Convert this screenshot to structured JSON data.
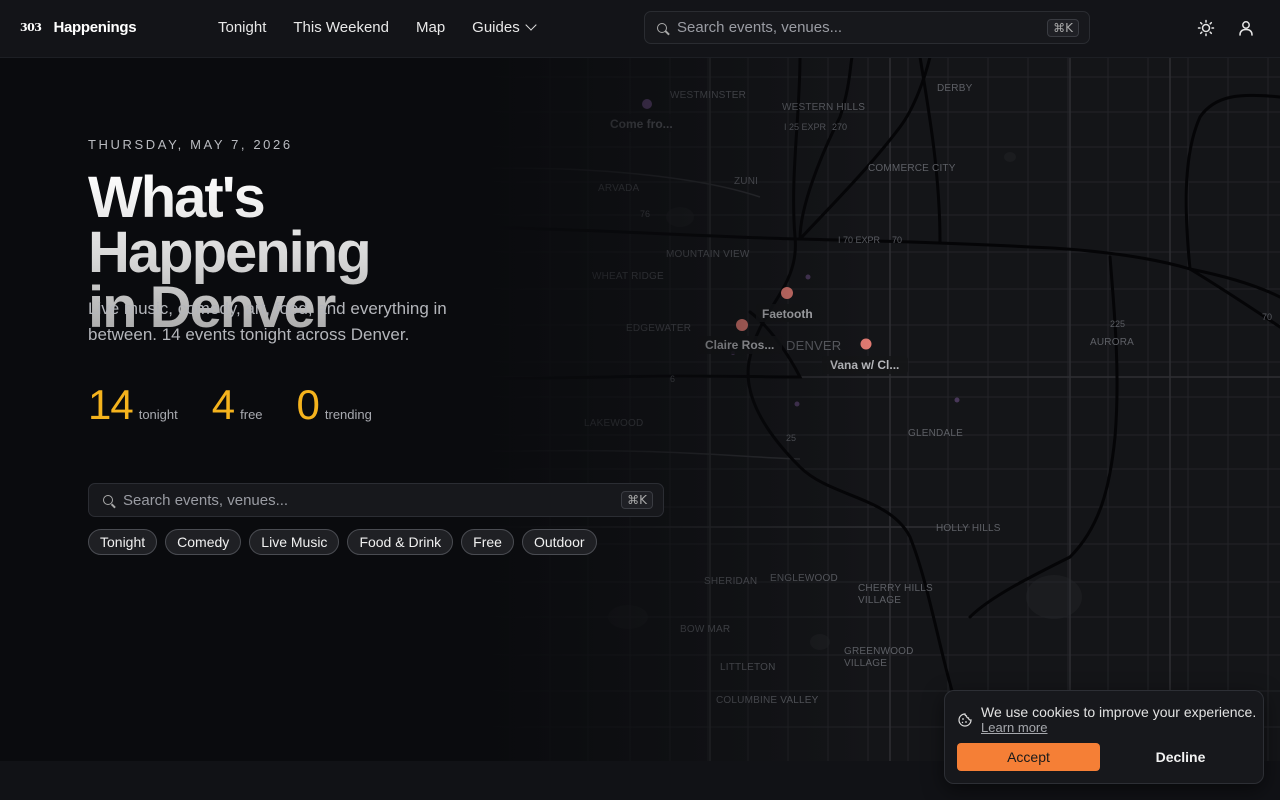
{
  "brand": {
    "mark": "303",
    "name": "Happenings"
  },
  "nav": {
    "items": [
      "Tonight",
      "This Weekend",
      "Map",
      "Guides"
    ]
  },
  "search": {
    "placeholder": "Search events, venues...",
    "shortcut": "⌘K"
  },
  "hero": {
    "date": "THURSDAY, MAY 7, 2026",
    "title_line1": "What's Happening",
    "title_line2": "in Denver",
    "subtitle": "Live music, comedy, art, food, and everything in between. 14 events tonight across Denver.",
    "stats": [
      {
        "value": "14",
        "label": "tonight"
      },
      {
        "value": "4",
        "label": "free"
      },
      {
        "value": "0",
        "label": "trending"
      }
    ],
    "chips": [
      "Tonight",
      "Comedy",
      "Live Music",
      "Food & Drink",
      "Free",
      "Outdoor"
    ]
  },
  "map": {
    "places": [
      "WESTMINSTER",
      "WESTERN HILLS",
      "DERBY",
      "COMMERCE CITY",
      "ARVADA",
      "ZUNI",
      "MOUNTAIN VIEW",
      "WHEAT RIDGE",
      "EDGEWATER",
      "DENVER",
      "AURORA",
      "LAKEWOOD",
      "GLENDALE",
      "HOLLY HILLS",
      "SHERIDAN",
      "ENGLEWOOD",
      "CHERRY HILLS",
      "VILLAGE",
      "BOW MAR",
      "GREENWOOD",
      "VILLAGE",
      "LITTLETON",
      "COLUMBINE VALLEY"
    ],
    "highways": [
      "I 25 EXPR",
      "270",
      "I 70 EXPR",
      "70",
      "76",
      "225",
      "25",
      "6",
      "70"
    ],
    "markers": [
      {
        "label": "Come fro...",
        "color": "#8a62a8"
      },
      {
        "label": "Faetooth",
        "color": "#e07a72"
      },
      {
        "label": "Claire Ros...",
        "color": "#e07a72"
      },
      {
        "label": "Vana w/ Cl...",
        "color": "#e07a72"
      }
    ]
  },
  "cookie": {
    "message": "We use cookies to improve your experience.",
    "link": "Learn more",
    "accept": "Accept",
    "decline": "Decline"
  },
  "colors": {
    "accent": "#f5b31d",
    "cta": "#f57f36",
    "background": "#0a0b0e"
  }
}
